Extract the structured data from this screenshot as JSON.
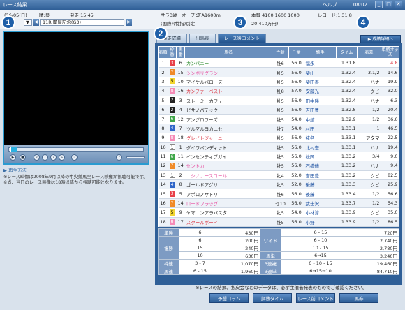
{
  "window": {
    "title": "レース結果",
    "help": "ヘルプ",
    "clock": "08:02",
    "minimize": "_",
    "maximize": "□",
    "close": "✕"
  },
  "info": {
    "date": "(26/05(日)",
    "weather": "晴:良",
    "start": "発走 15:45",
    "class": "サラ3歳上オープン",
    "course": "芝A1600m",
    "prize": "本賞 4100 1600 1000",
    "record": "レコード:1.31.8",
    "race_num": "11R",
    "race_name": "11R 関屋記念(G3)",
    "cond": "(国際)(特指)別定",
    "prize2": "20 410万円)"
  },
  "markers": [
    "1",
    "2",
    "3",
    "4"
  ],
  "video": {
    "play": "▶",
    "link": "▶ 再生方法",
    "note": "※レース映像は2008年9月以降の中央競馬全レース映像が視聴可能です。※尚、当日のレース映像は18時以降から視聴可能となります。"
  },
  "tabs": [
    "競走成績",
    "出馬表",
    "レース後コメント"
  ],
  "detail_button": "▶ 成績詳細へ",
  "headers": [
    "着順",
    "枠番",
    "馬番",
    "馬名",
    "性齢",
    "斤量",
    "騎手",
    "タイム",
    "着差",
    "単勝オッズ"
  ],
  "rows": [
    [
      "1",
      "3",
      "6",
      "カンパニー",
      "牡6",
      "56.0",
      "福永",
      "1.31.8",
      "",
      "4.8"
    ],
    [
      "2",
      "7",
      "15",
      "シンボリグラン",
      "牡5",
      "56.0",
      "柴山",
      "1.32.4",
      "3.1/2",
      "14.6"
    ],
    [
      "3",
      "5",
      "10",
      "マイケルバローズ",
      "牡5",
      "56.0",
      "柴田善",
      "1.32.4",
      "ハナ",
      "19.9"
    ],
    [
      "4",
      "8",
      "16",
      "カンファーベスト",
      "牡8",
      "57.0",
      "安藤光",
      "1.32.4",
      "クビ",
      "32.0"
    ],
    [
      "5",
      "2",
      "3",
      "ストーミーカフェ",
      "牡5",
      "56.0",
      "田中勝",
      "1.32.4",
      "ハナ",
      "6.3"
    ],
    [
      "6",
      "2",
      "4",
      "ピサノパテック",
      "牡5",
      "56.0",
      "吉田豊",
      "1.32.8",
      "1/2",
      "20.4"
    ],
    [
      "7",
      "6",
      "12",
      "アングロワーズ",
      "牡5",
      "54.0",
      "中舘",
      "1.32.9",
      "1/2",
      "36.6"
    ],
    [
      "8",
      "4",
      "7",
      "ツルマルヨカニセ",
      "牡7",
      "54.0",
      "村田",
      "1.33.1",
      "1",
      "46.5"
    ],
    [
      "9",
      "8",
      "18",
      "グレイトジャーニー",
      "牡5",
      "56.0",
      "蛯名",
      "1.33.1",
      "アタマ",
      "22.5"
    ],
    [
      "10",
      "1",
      "1",
      "ダイワバンディット",
      "牡5",
      "56.0",
      "北村宏",
      "1.33.1",
      "ハナ",
      "19.4"
    ],
    [
      "11",
      "6",
      "11",
      "インセンティブガイ",
      "牡5",
      "56.0",
      "松岡",
      "1.33.2",
      "3/4",
      "9.0"
    ],
    [
      "12",
      "7",
      "14",
      "セントカ",
      "牡5",
      "56.0",
      "石橋脩",
      "1.33.2",
      "ハナ",
      "9.4"
    ],
    [
      "13",
      "1",
      "2",
      "ニシノナースコール",
      "牝4",
      "52.0",
      "吉田豊",
      "1.33.2",
      "クビ",
      "82.5"
    ],
    [
      "14",
      "4",
      "8",
      "ゴールドアグリ",
      "牝5",
      "52.0",
      "後藤",
      "1.33.3",
      "クビ",
      "25.9"
    ],
    [
      "15",
      "3",
      "5",
      "アポロノサトリ",
      "牡6",
      "56.0",
      "後藤",
      "1.33.4",
      "1/2",
      "56.6"
    ],
    [
      "16",
      "7",
      "14",
      "ロードフラッグ",
      "セ10",
      "56.0",
      "武士沢",
      "1.33.7",
      "1/2",
      "54.3"
    ],
    [
      "17",
      "5",
      "9",
      "ヤマニンアラバスタ",
      "牝5",
      "54.0",
      "小林淳",
      "1.33.9",
      "クビ",
      "35.0"
    ],
    [
      "18",
      "8",
      "17",
      "スクールボーイ",
      "牡5",
      "56.0",
      "小野",
      "1.33.9",
      "1/2",
      "86.5"
    ]
  ],
  "payouts": {
    "win": {
      "label": "単勝",
      "combo": "6",
      "amount": "430円"
    },
    "place": {
      "label": "複勝",
      "items": [
        [
          "6",
          "200円"
        ],
        [
          "15",
          "240円"
        ],
        [
          "10",
          "630円"
        ]
      ]
    },
    "bracket": {
      "label": "枠連",
      "combo": "3 - 7",
      "amount": "1,070円"
    },
    "quinella": {
      "label": "馬連",
      "combo": "6 - 15",
      "amount": "1,960円"
    },
    "wide": {
      "label": "ワイド",
      "items": [
        [
          "6 - 15",
          "720円"
        ],
        [
          "6 - 10",
          "2,740円"
        ],
        [
          "10 - 15",
          "2,780円"
        ]
      ]
    },
    "exacta": {
      "label": "馬単",
      "combo": "6→15",
      "amount": "3,240円"
    },
    "trio": {
      "label": "3連複",
      "combo": "6 - 10 - 15",
      "amount": "19,460円"
    },
    "trifecta": {
      "label": "3連単",
      "combo": "6→15→10",
      "amount": "84,710円"
    }
  },
  "footnote": "※レースの結果、払戻金などのデータは、必ず主催者発表のものでご確認ください。",
  "buttons": [
    "予想コラム",
    "調教タイム",
    "レース前コメント",
    "馬券"
  ],
  "colors": {
    "accent": "#2f5f97",
    "frame": [
      "#ffffff",
      "#222222",
      "#e8414a",
      "#2f66c9",
      "#f2d531",
      "#3fa64a",
      "#f08a27",
      "#f58bb7"
    ]
  }
}
